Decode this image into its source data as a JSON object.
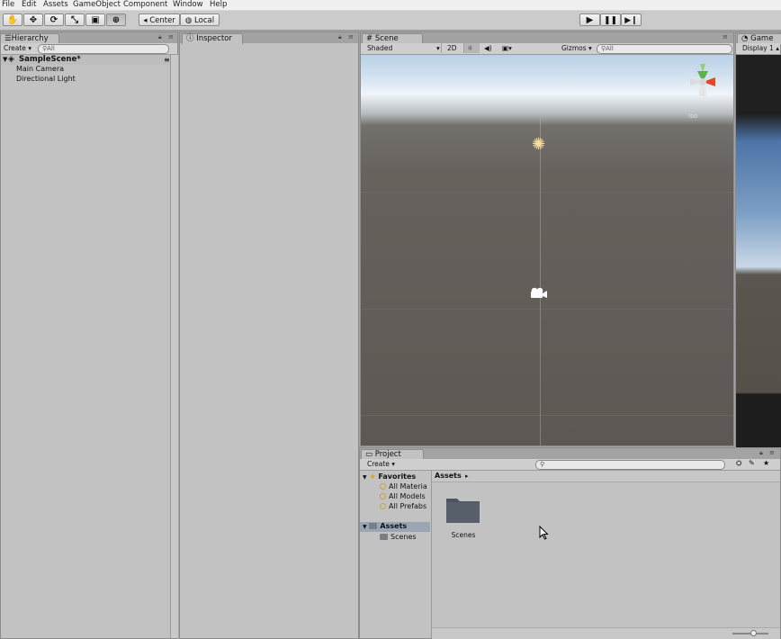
{
  "menu": [
    "File",
    "Edit",
    "Assets",
    "GameObject",
    "Component",
    "Window",
    "Help"
  ],
  "toolbar": {
    "tools": [
      {
        "name": "hand-tool",
        "glyph": "✋"
      },
      {
        "name": "move-tool",
        "glyph": "✥"
      },
      {
        "name": "rotate-tool",
        "glyph": "⟳"
      },
      {
        "name": "scale-tool",
        "glyph": "⤡"
      },
      {
        "name": "rect-tool",
        "glyph": "▣"
      },
      {
        "name": "transform-tool",
        "glyph": "⊕"
      }
    ],
    "pivot": "Center",
    "space": "Local",
    "play_icons": [
      "play-icon",
      "pause-icon",
      "step-icon"
    ]
  },
  "hierarchy": {
    "tab": "Hierarchy",
    "create": "Create",
    "search_placeholder": "All",
    "scene_name": "SampleScene*",
    "items": [
      "Main Camera",
      "Directional Light"
    ]
  },
  "inspector": {
    "tab": "Inspector"
  },
  "scene": {
    "tab": "Scene",
    "shading": "Shaded",
    "mode_2d": "2D",
    "gizmos": "Gizmos",
    "search_placeholder": "All",
    "persp_label": "Iso"
  },
  "game": {
    "tab": "Game",
    "display": "Display 1"
  },
  "project": {
    "tab": "Project",
    "create": "Create",
    "favorites_label": "Favorites",
    "favorites": [
      "All Materia",
      "All Models",
      "All Prefabs"
    ],
    "assets_label": "Assets",
    "assets_children": [
      "Scenes"
    ],
    "breadcrumb": "Assets",
    "grid_items": [
      {
        "label": "Scenes",
        "icon": "folder-icon"
      }
    ]
  },
  "colors": {
    "panel": "#c2c2c2",
    "dock_background": "#a3a3a3",
    "sky": "#cfe0ef",
    "ground": "#625d58",
    "selection": "#9aa6b4"
  }
}
